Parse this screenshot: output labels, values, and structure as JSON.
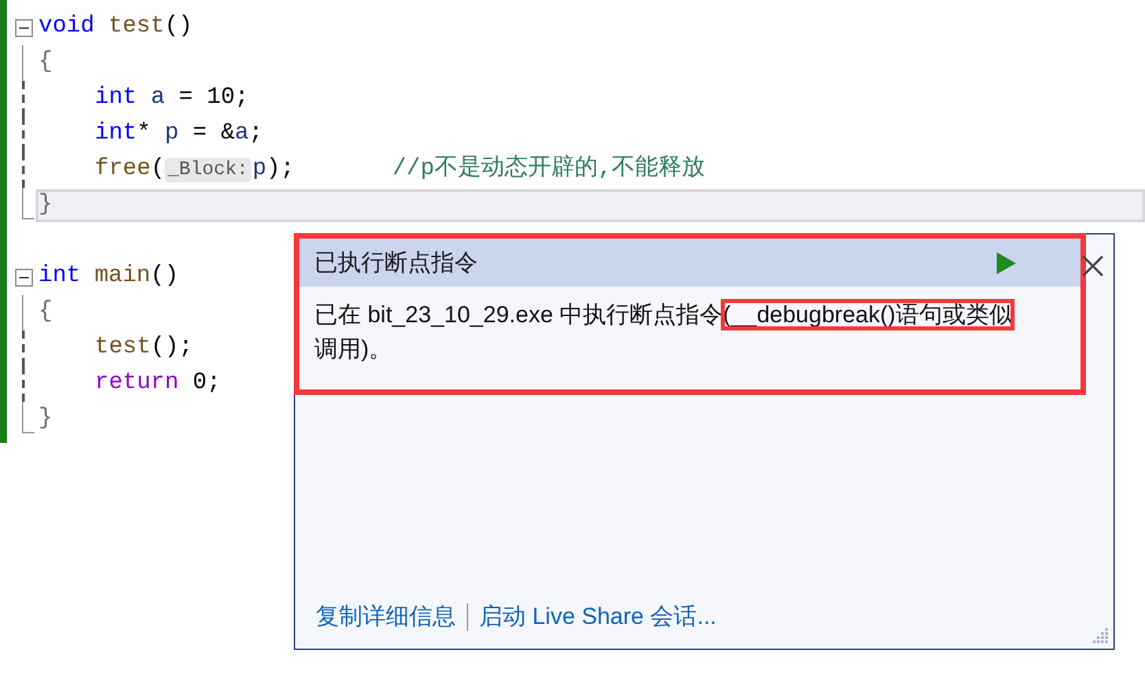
{
  "editor": {
    "functions": [
      {
        "collapsible": true,
        "lines": [
          {
            "current": false,
            "indented": false,
            "tokens": [
              {
                "text": "void ",
                "kind": "keyword"
              },
              {
                "text": "test",
                "kind": "function"
              },
              {
                "text": "()",
                "kind": "plain"
              }
            ]
          },
          {
            "current": false,
            "indented": false,
            "tokens": [
              {
                "text": "{",
                "kind": "brace"
              }
            ]
          },
          {
            "current": false,
            "indented": true,
            "tokens": [
              {
                "text": "int ",
                "kind": "keyword"
              },
              {
                "text": "a",
                "kind": "variable"
              },
              {
                "text": " = 10;",
                "kind": "plain"
              }
            ]
          },
          {
            "current": false,
            "indented": true,
            "tokens": [
              {
                "text": "int",
                "kind": "keyword"
              },
              {
                "text": "* ",
                "kind": "plain"
              },
              {
                "text": "p",
                "kind": "variable"
              },
              {
                "text": " = &",
                "kind": "plain"
              },
              {
                "text": "a",
                "kind": "variable"
              },
              {
                "text": ";",
                "kind": "plain"
              }
            ]
          },
          {
            "current": false,
            "indented": true,
            "tokens": [
              {
                "text": "free",
                "kind": "function"
              },
              {
                "text": "(",
                "kind": "plain"
              },
              {
                "text": "_Block:",
                "kind": "hint"
              },
              {
                "text": "p",
                "kind": "variable"
              },
              {
                "text": ");       ",
                "kind": "plain"
              },
              {
                "text": "//p不是动态开辟的,不能释放",
                "kind": "comment"
              }
            ]
          },
          {
            "current": true,
            "indented": false,
            "tokens": [
              {
                "text": "}",
                "kind": "brace"
              }
            ]
          }
        ]
      },
      {
        "collapsible": true,
        "lines": [
          {
            "current": false,
            "indented": false,
            "tokens": [
              {
                "text": "int ",
                "kind": "keyword"
              },
              {
                "text": "main",
                "kind": "function"
              },
              {
                "text": "()",
                "kind": "plain"
              }
            ]
          },
          {
            "current": false,
            "indented": false,
            "tokens": [
              {
                "text": "{",
                "kind": "brace"
              }
            ]
          },
          {
            "current": false,
            "indented": true,
            "tokens": [
              {
                "text": "test",
                "kind": "function"
              },
              {
                "text": "();",
                "kind": "plain"
              }
            ]
          },
          {
            "current": false,
            "indented": true,
            "tokens": [
              {
                "text": "return",
                "kind": "control"
              },
              {
                "text": " 0;",
                "kind": "plain"
              }
            ]
          },
          {
            "current": false,
            "indented": false,
            "tokens": [
              {
                "text": "}",
                "kind": "brace"
              }
            ]
          }
        ]
      }
    ]
  },
  "exception_popup": {
    "title": "已执行断点指令",
    "message": [
      {
        "text": "已在 bit_23_10_29.exe 中执行断点指令",
        "marked": false
      },
      {
        "text": "(__debugbreak()语句或类似",
        "marked": true
      },
      {
        "text": "调用)。",
        "marked": false
      }
    ],
    "links": [
      "复制详细信息",
      "启动 Live Share 会话..."
    ]
  }
}
